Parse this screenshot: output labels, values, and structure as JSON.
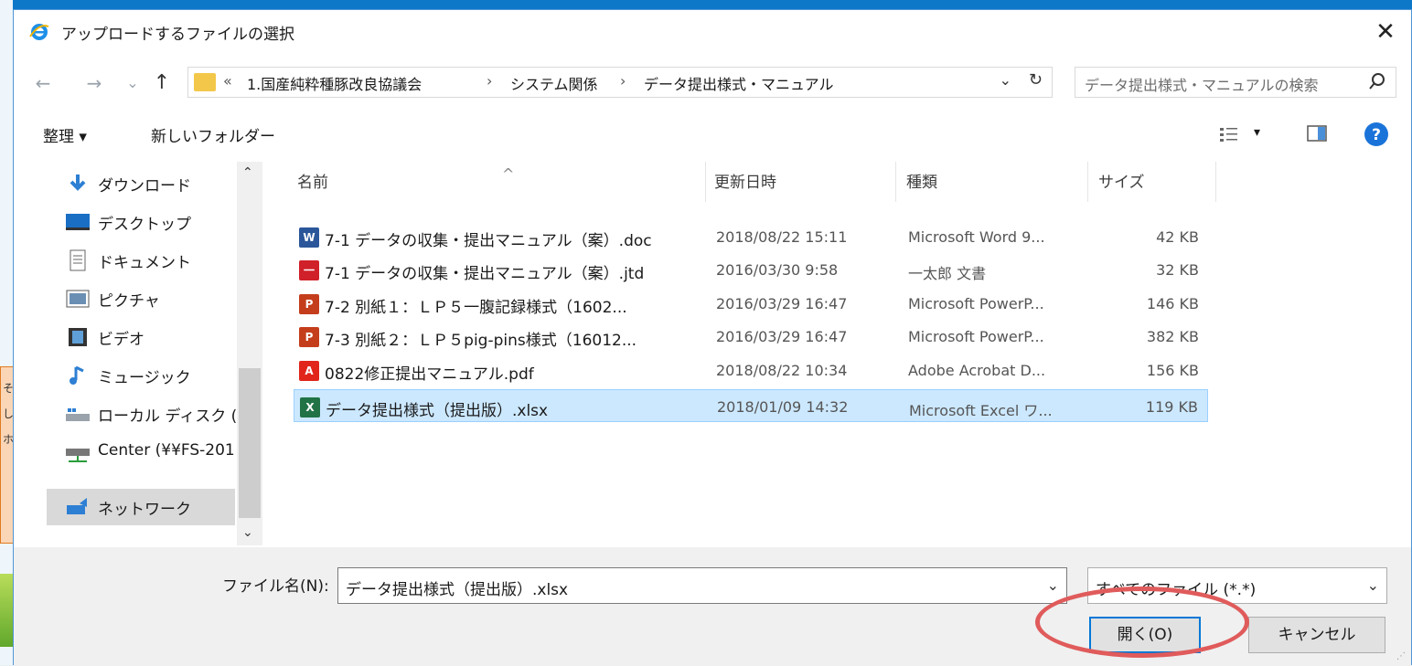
{
  "background": {
    "note_chars": [
      "そ",
      "し",
      "ホ"
    ]
  },
  "dialog": {
    "title": "アップロードするファイルの選択",
    "close": "✕"
  },
  "nav": {
    "back": "←",
    "forward": "→",
    "recent": "⌄",
    "up": "↑",
    "overflow": "«",
    "breadcrumbs": [
      "1.国産純粋種豚改良協議会",
      "システム関係",
      "データ提出様式・マニュアル"
    ],
    "separator": "›",
    "search_placeholder": "データ提出様式・マニュアルの検索"
  },
  "toolbar": {
    "organize": "整理 ▾",
    "new_folder": "新しいフォルダー",
    "view_dropdown": "▾"
  },
  "sidebar": {
    "items": [
      {
        "label": "ダウンロード",
        "icon": "download-icon",
        "selected": false
      },
      {
        "label": "デスクトップ",
        "icon": "desktop-icon",
        "selected": false
      },
      {
        "label": "ドキュメント",
        "icon": "documents-icon",
        "selected": false
      },
      {
        "label": "ピクチャ",
        "icon": "pictures-icon",
        "selected": false
      },
      {
        "label": "ビデオ",
        "icon": "video-icon",
        "selected": false
      },
      {
        "label": "ミュージック",
        "icon": "music-icon",
        "selected": false
      },
      {
        "label": "ローカル ディスク (C",
        "icon": "local-disk-icon",
        "selected": false
      },
      {
        "label": "Center (¥¥FS-201",
        "icon": "network-drive-icon",
        "selected": false
      },
      {
        "label": "ネットワーク",
        "icon": "network-icon",
        "selected": true
      }
    ]
  },
  "filelist": {
    "columns": [
      "名前",
      "更新日時",
      "種類",
      "サイズ"
    ],
    "sort_indicator": "^",
    "rows": [
      {
        "name": "7-1 データの収集・提出マニュアル（案）.doc",
        "date": "2018/08/22 15:11",
        "type": "Microsoft Word 9...",
        "size": "42 KB",
        "icon": "word-icon",
        "icon_label": "W",
        "color": "#2b579a",
        "selected": false
      },
      {
        "name": "7-1 データの収集・提出マニュアル（案）.jtd",
        "date": "2016/03/30 9:58",
        "type": "一太郎 文書",
        "size": "32 KB",
        "icon": "ichitaro-icon",
        "icon_label": "一",
        "color": "#d0202a",
        "selected": false
      },
      {
        "name": "7-2 別紙１：ＬＰ５一腹記録様式（1602...",
        "date": "2016/03/29 16:47",
        "type": "Microsoft PowerP...",
        "size": "146 KB",
        "icon": "powerpoint-icon",
        "icon_label": "P",
        "color": "#c43e1c",
        "selected": false
      },
      {
        "name": "7-3 別紙２：ＬＰ５pig-pins様式（16012...",
        "date": "2016/03/29 16:47",
        "type": "Microsoft PowerP...",
        "size": "382 KB",
        "icon": "powerpoint-icon",
        "icon_label": "P",
        "color": "#c43e1c",
        "selected": false
      },
      {
        "name": "0822修正提出マニュアル.pdf",
        "date": "2018/08/22 10:34",
        "type": "Adobe Acrobat D...",
        "size": "156 KB",
        "icon": "pdf-icon",
        "icon_label": "A",
        "color": "#e1251b",
        "selected": false
      },
      {
        "name": "データ提出様式（提出版）.xlsx",
        "date": "2018/01/09 14:32",
        "type": "Microsoft Excel ワ...",
        "size": "119 KB",
        "icon": "excel-icon",
        "icon_label": "X",
        "color": "#217346",
        "selected": true
      }
    ]
  },
  "bottom": {
    "filename_label": "ファイル名(N):",
    "filename_value": "データ提出様式（提出版）.xlsx",
    "filetype_value": "すべてのファイル (*.*)",
    "open_label": "開く(O)",
    "cancel_label": "キャンセル"
  },
  "colors": {
    "accent": "#0078d7",
    "selection": "#cce8ff",
    "annotation_circle": "#e05b5b"
  }
}
